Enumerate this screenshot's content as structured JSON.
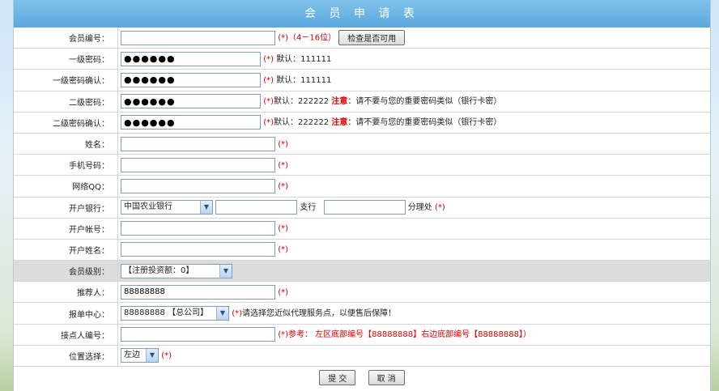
{
  "title": "会 员 申 请 表",
  "colors": {
    "title_bar": "#6ab5e3",
    "required": "#cc0000",
    "warning": "#e00000"
  },
  "fields": {
    "member_id": {
      "label": "会员编号：",
      "hint": "(*)（4－16位）",
      "check_button": "检查是否可用"
    },
    "pwd1": {
      "label": "一级密码：",
      "value": "●●●●●●",
      "req": "(*)",
      "hint": "默认：111111"
    },
    "pwd1_confirm": {
      "label": "一级密码确认：",
      "value": "●●●●●●",
      "req": "(*)",
      "hint": "默认：111111"
    },
    "pwd2": {
      "label": "二级密码：",
      "value": "●●●●●●",
      "req": "(*)",
      "hint_prefix": "默认：222222 ",
      "warn": "注意",
      "hint_suffix": "：请不要与您的重要密码类似（银行卡密）"
    },
    "pwd2_confirm": {
      "label": "二级密码确认：",
      "value": "●●●●●●",
      "req": "(*)",
      "hint_prefix": "默认：222222 ",
      "warn": "注意",
      "hint_suffix": "：请不要与您的重要密码类似（银行卡密）"
    },
    "name": {
      "label": "姓名：",
      "req": "(*)"
    },
    "phone": {
      "label": "手机号码：",
      "req": "(*)"
    },
    "qq": {
      "label": "网络QQ：",
      "req": "(*)"
    },
    "bank": {
      "label": "开户银行：",
      "selected": "中国农业银行",
      "branch_label": "支行",
      "sub_label": "分理处",
      "req": "(*)"
    },
    "account": {
      "label": "开户帐号：",
      "req": "(*)"
    },
    "account_name": {
      "label": "开户姓名：",
      "req": "(*)"
    },
    "level": {
      "label": "会员级别：",
      "selected": "【注册投资额：0】"
    },
    "referrer": {
      "label": "推荐人：",
      "value": "88888888",
      "req": "(*)"
    },
    "center": {
      "label": "报单中心：",
      "selected": "88888888 【总公司】",
      "req": "(*)",
      "hint": "请选择您近似代理服务点，以便售后保障！"
    },
    "contact": {
      "label": "接点人编号：",
      "req": "(*)",
      "ref_label": "参考：",
      "ref_text": "左区底部编号【88888888】右边底部编号【88888888】）"
    },
    "position": {
      "label": "位置选择：",
      "selected": "左边",
      "req": "(*)"
    }
  },
  "buttons": {
    "submit": "提 交",
    "cancel": "取 消"
  }
}
